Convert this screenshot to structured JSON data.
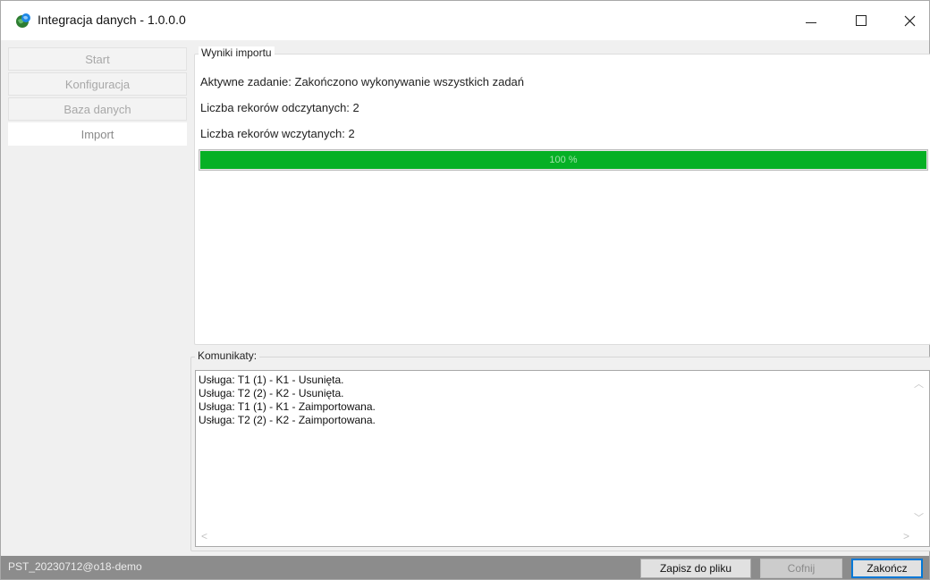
{
  "window": {
    "title": "Integracja danych - 1.0.0.0"
  },
  "sidebar": {
    "items": [
      {
        "label": "Start"
      },
      {
        "label": "Konfiguracja"
      },
      {
        "label": "Baza danych"
      },
      {
        "label": "Import",
        "active": true
      }
    ]
  },
  "results": {
    "group_title": "Wyniki importu",
    "active_task": "Aktywne zadanie: Zakończono wykonywanie wszystkich zadań",
    "records_read": "Liczba rekorów odczytanych: 2",
    "records_loaded": "Liczba rekorów wczytanych: 2",
    "progress_value": 100,
    "progress_label": "100 %",
    "progress_color": "#06b025"
  },
  "messages": {
    "group_title": "Komunikaty:",
    "lines": [
      "Usługa: T1 (1) - K1 - Usunięta.",
      "Usługa: T2 (2) - K2 - Usunięta.",
      "Usługa: T1 (1) - K1 - Zaimportowana.",
      "Usługa: T2 (2) - K2 - Zaimportowana."
    ]
  },
  "statusbar": {
    "connection": "PST_20230712@o18-demo",
    "save_label": "Zapisz do pliku",
    "back_label": "Cofnij",
    "finish_label": "Zakończ"
  },
  "icons": {
    "app": "globe-app-icon",
    "minimize": "minimize-icon",
    "maximize": "maximize-icon",
    "close": "close-icon"
  }
}
